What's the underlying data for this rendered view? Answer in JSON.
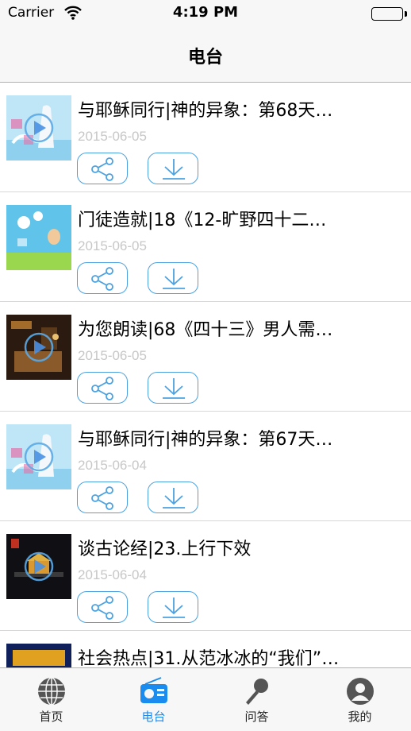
{
  "status_bar": {
    "carrier": "Carrier",
    "time": "4:19 PM"
  },
  "nav": {
    "title": "电台"
  },
  "items": [
    {
      "title": "与耶稣同行|神的异象：第68天…",
      "date": "2015-06-05",
      "thumb": "jesus-walk"
    },
    {
      "title": "门徒造就|18《12-旷野四十二…",
      "date": "2015-06-05",
      "thumb": "disciple"
    },
    {
      "title": "为您朗读|68《四十三》男人需…",
      "date": "2015-06-05",
      "thumb": "reading"
    },
    {
      "title": "与耶稣同行|神的异象：第67天…",
      "date": "2015-06-04",
      "thumb": "jesus-walk"
    },
    {
      "title": "谈古论经|23.上行下效",
      "date": "2015-06-04",
      "thumb": "ancient"
    },
    {
      "title": "社会热点|31.从范冰冰的“我们”…",
      "date": "",
      "thumb": "social"
    }
  ],
  "tabs": [
    {
      "label": "首页",
      "icon": "globe-icon",
      "active": false
    },
    {
      "label": "电台",
      "icon": "radio-icon",
      "active": true
    },
    {
      "label": "问答",
      "icon": "microphone-icon",
      "active": false
    },
    {
      "label": "我的",
      "icon": "person-icon",
      "active": false
    }
  ],
  "colors": {
    "accent": "#1a8cf0",
    "button_border": "#4ca2e0",
    "date_text": "#c7c7c7"
  }
}
